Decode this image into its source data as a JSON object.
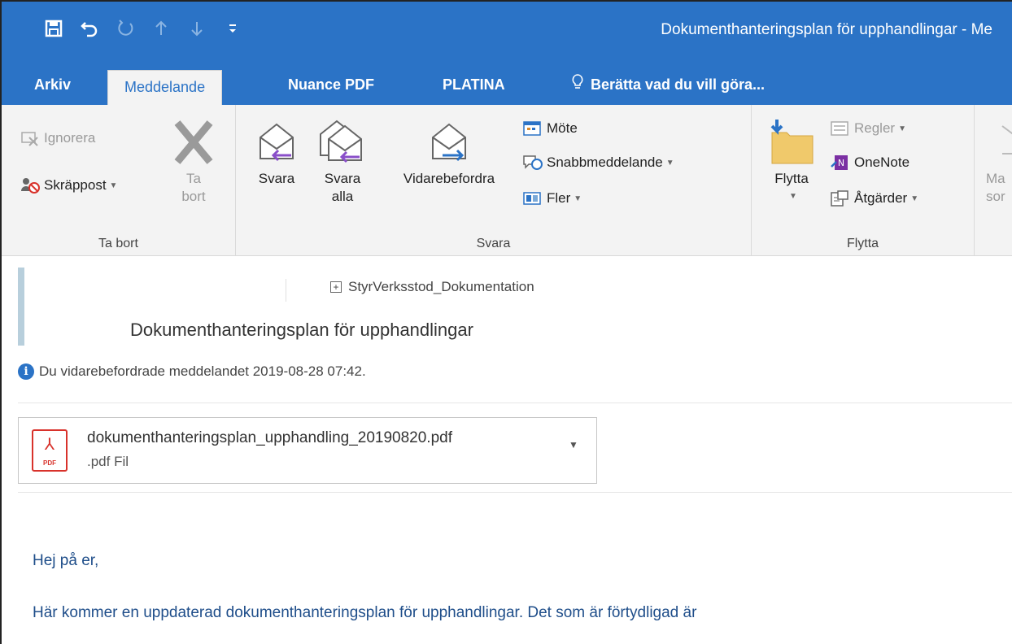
{
  "window": {
    "title": "Dokumenthanteringsplan för upphandlingar - Me"
  },
  "qat": {
    "save_icon": "save-icon",
    "undo_icon": "undo-icon",
    "redo_icon": "redo-icon",
    "up_icon": "arrow-up-icon",
    "down_icon": "arrow-down-icon",
    "customize_icon": "customize-icon"
  },
  "tabs": [
    {
      "label": "Arkiv"
    },
    {
      "label": "Meddelande"
    },
    {
      "label": "Nuance PDF"
    },
    {
      "label": "PLATINA"
    },
    {
      "label": "Berätta vad du vill göra..."
    }
  ],
  "ribbon": {
    "ta_bort": {
      "label": "Ta bort",
      "ignorera": "Ignorera",
      "skrappost": "Skräppost",
      "ta_bort_line1": "Ta",
      "ta_bort_line2": "bort"
    },
    "svara": {
      "label": "Svara",
      "svara": "Svara",
      "svara_alla_line1": "Svara",
      "svara_alla_line2": "alla",
      "vidarebefordra": "Vidarebefordra",
      "mote": "Möte",
      "snabbmeddelande": "Snabbmeddelande",
      "fler": "Fler"
    },
    "flytta": {
      "label": "Flytta",
      "flytta": "Flytta",
      "regler": "Regler",
      "onenote": "OneNote",
      "atgarder": "Åtgärder"
    },
    "partial": {
      "line1": "Ma",
      "line2": "sor"
    }
  },
  "message": {
    "folder": "StyrVerksstod_Dokumentation",
    "subject": "Dokumenthanteringsplan för upphandlingar",
    "info": "Du vidarebefordrade meddelandet 2019-08-28 07:42.",
    "attachment": {
      "name": "dokumenthanteringsplan_upphandling_20190820.pdf",
      "type": ".pdf Fil",
      "icon_text": "PDF"
    },
    "body": [
      "Hej på er,",
      "Här kommer en uppdaterad dokumenthanteringsplan för upphandlingar. Det som är förtydligad är"
    ]
  }
}
